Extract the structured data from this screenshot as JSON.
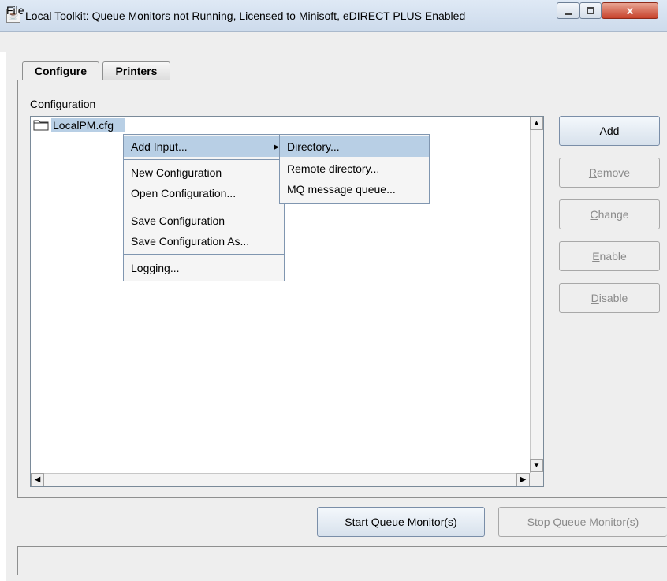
{
  "window": {
    "title": "Local Toolkit: Queue Monitors not Running, Licensed to Minisoft, eDIRECT PLUS Enabled",
    "close_glyph": "x"
  },
  "menubar": {
    "file": "File"
  },
  "tabs": [
    {
      "label": "Configure",
      "selected": true
    },
    {
      "label": "Printers",
      "selected": false
    }
  ],
  "configuration": {
    "label": "Configuration",
    "tree_items": [
      "LocalPM.cfg"
    ]
  },
  "context_menu": {
    "items": [
      {
        "label": "Add Input...",
        "has_submenu": true,
        "highlighted": true
      },
      {
        "label": "New Configuration"
      },
      {
        "label": "Open Configuration..."
      },
      {
        "label": "Save Configuration"
      },
      {
        "label": "Save Configuration As..."
      },
      {
        "label": "Logging..."
      }
    ],
    "submenu": [
      {
        "label": "Directory...",
        "highlighted": true
      },
      {
        "label": "Remote directory..."
      },
      {
        "label": "MQ message queue..."
      }
    ]
  },
  "buttons": {
    "add": {
      "prefix": "",
      "mnemonic": "A",
      "rest": "dd",
      "enabled": true
    },
    "remove": {
      "prefix": "",
      "mnemonic": "R",
      "rest": "emove",
      "enabled": false
    },
    "change": {
      "prefix": "",
      "mnemonic": "C",
      "rest": "hange",
      "enabled": false
    },
    "enable": {
      "prefix": "",
      "mnemonic": "E",
      "rest": "nable",
      "enabled": false
    },
    "disable": {
      "prefix": "",
      "mnemonic": "D",
      "rest": "isable",
      "enabled": false
    },
    "start": {
      "prefix": "St",
      "mnemonic": "a",
      "rest": "rt Queue Monitor(s)",
      "enabled": true
    },
    "stop": {
      "label": "Stop Queue Monitor(s)",
      "enabled": false
    }
  },
  "status_bar": {
    "text": ""
  },
  "colors": {
    "highlight": "#b8cfe5",
    "window_bg": "#eeeeee",
    "disabled_text": "#8a8a8a"
  },
  "icons": [
    "java-app-icon",
    "folder-icon",
    "submenu-arrow-icon",
    "scroll-up-icon",
    "scroll-down-icon",
    "scroll-left-icon",
    "scroll-right-icon"
  ]
}
